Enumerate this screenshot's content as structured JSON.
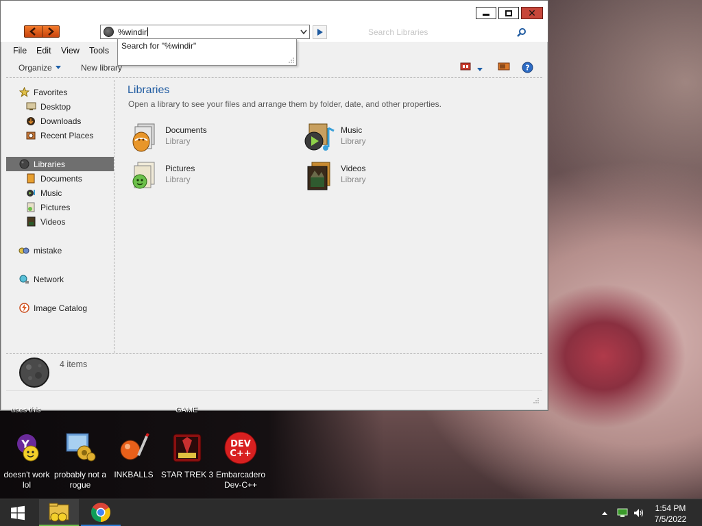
{
  "window": {
    "controls": {
      "minimize": "minimize",
      "maximize": "maximize",
      "close": "✕"
    },
    "address": {
      "value": "%windir",
      "suggestion": "Search for \"%windir\""
    },
    "search": {
      "placeholder": "Search Libraries"
    },
    "menu": [
      "File",
      "Edit",
      "View",
      "Tools"
    ],
    "commands": {
      "organize": "Organize",
      "new_library": "New library"
    },
    "nav": {
      "favorites": {
        "label": "Favorites",
        "items": [
          "Desktop",
          "Downloads",
          "Recent Places"
        ]
      },
      "libraries": {
        "label": "Libraries",
        "items": [
          "Documents",
          "Music",
          "Pictures",
          "Videos"
        ]
      },
      "homegroup": "mistake",
      "network": "Network",
      "image_catalog": "Image Catalog"
    },
    "content": {
      "title": "Libraries",
      "subtitle": "Open a library to see your files and arrange them by folder, date, and other properties.",
      "libraries": [
        {
          "name": "Documents",
          "kind": "Library",
          "icon": "documents-library-icon"
        },
        {
          "name": "Music",
          "kind": "Library",
          "icon": "music-library-icon"
        },
        {
          "name": "Pictures",
          "kind": "Library",
          "icon": "pictures-library-icon"
        },
        {
          "name": "Videos",
          "kind": "Library",
          "icon": "videos-library-icon"
        }
      ]
    },
    "details": {
      "count": "4 items"
    }
  },
  "desktop": {
    "cutoff_labels": [
      "uses this",
      "GAME"
    ],
    "icons": [
      {
        "label": "doesn't work lol",
        "icon": "yahoo-messenger-icon"
      },
      {
        "label": "probably not a rogue",
        "icon": "system-settings-icon"
      },
      {
        "label": "INKBALLS",
        "icon": "inkballs-icon"
      },
      {
        "label": "STAR TREK 3",
        "icon": "star-trek-game-icon"
      },
      {
        "label": "Embarcadero Dev-C++",
        "icon": "dev-cpp-icon"
      }
    ]
  },
  "taskbar": {
    "clock": {
      "time": "1:54 PM",
      "date": "7/5/2022"
    },
    "tray_icons": [
      "show-hidden-icons",
      "network-icon",
      "volume-icon"
    ]
  },
  "colors": {
    "accent_title": "#1e5aa0",
    "nav_selected": "#6f6f6f",
    "taskbar": "#2c2c2c",
    "close_button": "#c7463a"
  }
}
